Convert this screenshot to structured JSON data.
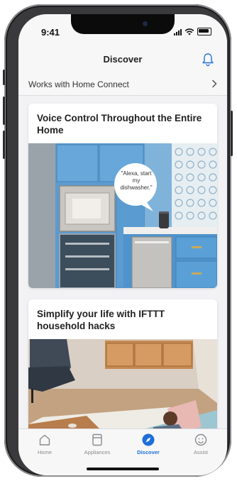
{
  "status": {
    "time": "9:41"
  },
  "header": {
    "title": "Discover"
  },
  "home_connect": {
    "label": "Works with Home Connect"
  },
  "cards": [
    {
      "title": "Voice Control Throughout the Entire Home",
      "speech": "\"Alexa, start my dishwasher.\""
    },
    {
      "title": "Simplify your life with IFTTT household hacks"
    }
  ],
  "tabs": [
    {
      "label": "Home",
      "icon": "house-icon"
    },
    {
      "label": "Appliances",
      "icon": "appliance-icon"
    },
    {
      "label": "Discover",
      "icon": "compass-icon",
      "active": true
    },
    {
      "label": "Assist",
      "icon": "smiley-icon"
    }
  ],
  "colors": {
    "accent": "#1e6fd9",
    "background": "#f2f2f4"
  }
}
